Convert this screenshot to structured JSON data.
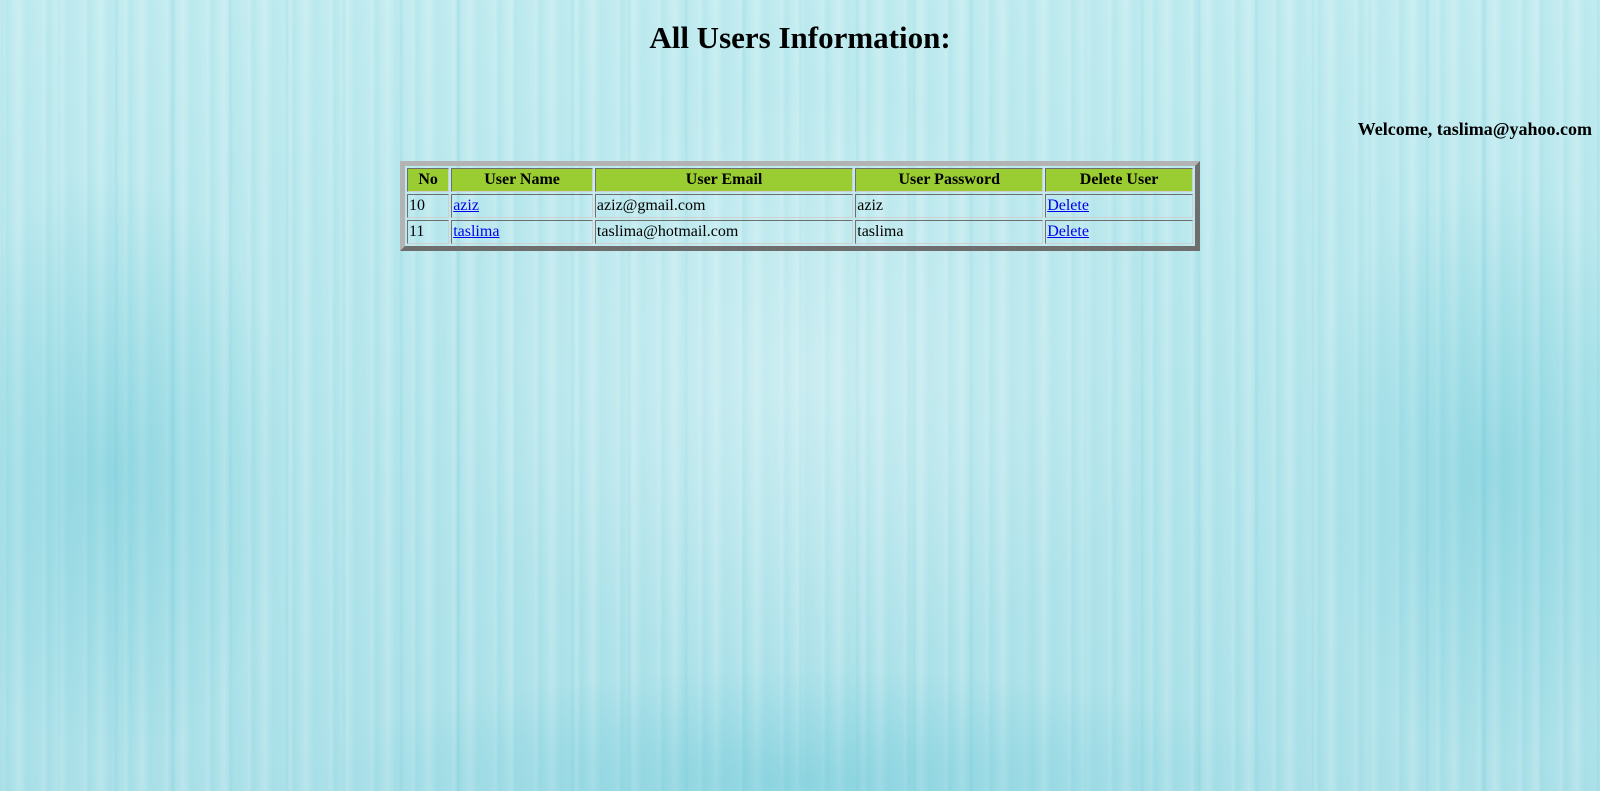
{
  "page": {
    "title": "All Users Information:",
    "welcome": "Welcome, taslima@yahoo.com"
  },
  "table": {
    "headers": {
      "no": "No",
      "name": "User Name",
      "email": "User Email",
      "password": "User Password",
      "delete": "Delete User"
    },
    "rows": [
      {
        "no": "10",
        "name": "aziz",
        "email": "aziz@gmail.com",
        "password": "aziz",
        "delete_label": "Delete"
      },
      {
        "no": "11",
        "name": "taslima",
        "email": "taslima@hotmail.com",
        "password": "taslima",
        "delete_label": "Delete"
      }
    ]
  },
  "colors": {
    "header_background": "#9acd32",
    "link": "#0000ee",
    "page_background": "#b7e6ec"
  }
}
